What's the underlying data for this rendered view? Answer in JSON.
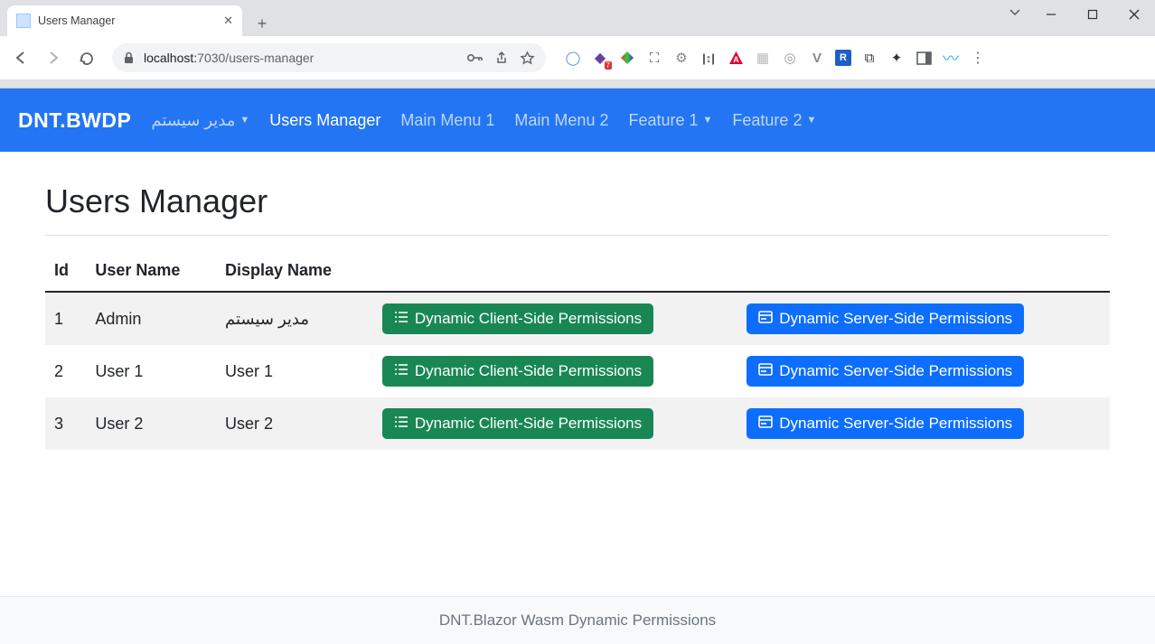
{
  "browser": {
    "tab_title": "Users Manager",
    "url_host": "localhost:",
    "url_port_path": "7030/users-manager"
  },
  "navbar": {
    "brand": "DNT.BWDP",
    "items": [
      {
        "label": "مدیر سیستم",
        "dropdown": true,
        "active": false
      },
      {
        "label": "Users Manager",
        "dropdown": false,
        "active": true
      },
      {
        "label": "Main Menu 1",
        "dropdown": false,
        "active": false
      },
      {
        "label": "Main Menu 2",
        "dropdown": false,
        "active": false
      },
      {
        "label": "Feature 1",
        "dropdown": true,
        "active": false
      },
      {
        "label": "Feature 2",
        "dropdown": true,
        "active": false
      }
    ]
  },
  "page_title": "Users Manager",
  "table": {
    "headers": [
      "Id",
      "User Name",
      "Display Name",
      "",
      ""
    ],
    "rows": [
      {
        "id": "1",
        "username": "Admin",
        "display": "مدیر سیستم"
      },
      {
        "id": "2",
        "username": "User 1",
        "display": "User 1"
      },
      {
        "id": "3",
        "username": "User 2",
        "display": "User 2"
      }
    ],
    "client_btn_label": "Dynamic Client-Side Permissions",
    "server_btn_label": "Dynamic Server-Side Permissions"
  },
  "footer": "DNT.Blazor Wasm Dynamic Permissions"
}
